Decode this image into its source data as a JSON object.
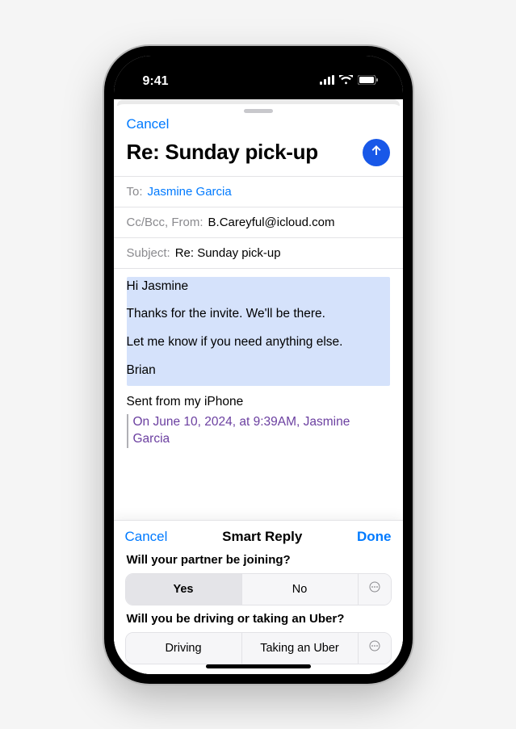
{
  "status": {
    "time": "9:41"
  },
  "compose": {
    "cancel": "Cancel",
    "title": "Re: Sunday pick-up",
    "to_label": "To:",
    "recipient": "Jasmine Garcia",
    "ccbcc_label": "Cc/Bcc, From:",
    "from_value": "B.Careyful@icloud.com",
    "subject_label": "Subject:",
    "subject_value": "Re: Sunday pick-up",
    "body_greeting": "Hi Jasmine",
    "body_line1": "Thanks for the invite. We'll be there.",
    "body_line2": "Let me know if you need anything else.",
    "body_signoff": "Brian",
    "signature": "Sent from my iPhone",
    "quoted_meta": "On June 10, 2024, at 9:39AM, Jasmine Garcia"
  },
  "smart_reply": {
    "cancel": "Cancel",
    "title": "Smart Reply",
    "done": "Done",
    "q1": {
      "question": "Will your partner be joining?",
      "opt_yes": "Yes",
      "opt_no": "No"
    },
    "q2": {
      "question": "Will you be driving or taking an Uber?",
      "opt_a": "Driving",
      "opt_b": "Taking an Uber"
    }
  }
}
